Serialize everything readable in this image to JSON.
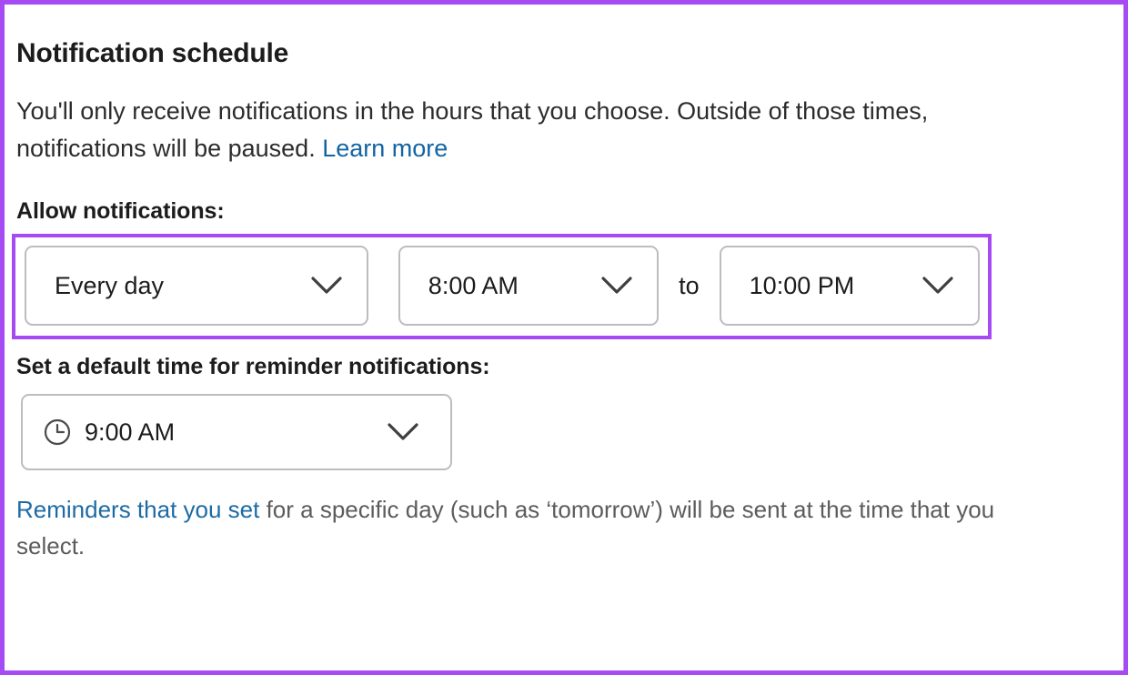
{
  "section": {
    "title": "Notification schedule",
    "description_part1": "You'll only receive notifications in the hours that you choose. Outside of those times, notifications will be paused.",
    "description_link": "Learn more"
  },
  "allow_notifications": {
    "label": "Allow notifications:",
    "day_select": {
      "value": "Every day",
      "icon": "chevron-down-icon"
    },
    "start_time_select": {
      "value": "8:00 AM",
      "icon": "chevron-down-icon"
    },
    "separator": "to",
    "end_time_select": {
      "value": "10:00 PM",
      "icon": "chevron-down-icon"
    }
  },
  "reminder": {
    "label": "Set a default time for reminder notifications:",
    "time_select": {
      "value": "9:00 AM",
      "leading_icon": "clock-icon",
      "icon": "chevron-down-icon"
    },
    "footnote_link": "Reminders that you set",
    "footnote_text": " for a specific day (such as ‘tomorrow’) will be sent at the time that you select."
  },
  "colors": {
    "highlight_purple": "#a64bf4",
    "link_blue": "#1264a3",
    "text_primary": "#1d1c1d",
    "text_muted": "#5c5c5c",
    "border_gray": "#bdbdbd"
  }
}
